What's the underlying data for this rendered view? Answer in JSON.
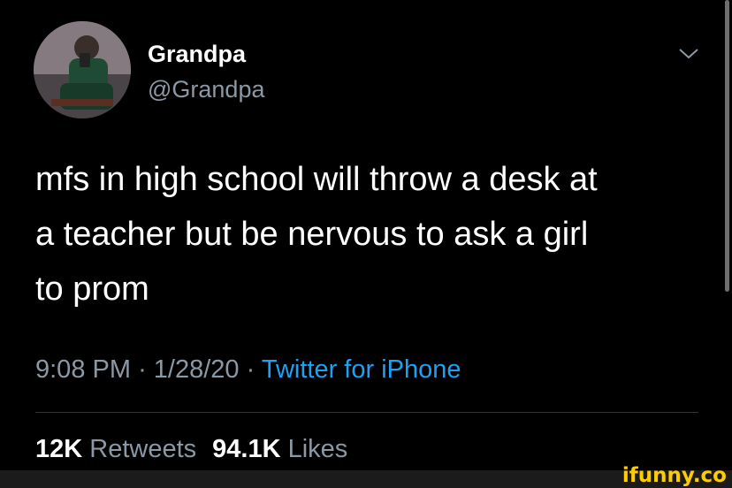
{
  "tweet": {
    "author": {
      "display_name": "Grandpa",
      "handle": "@Grandpa",
      "avatar_icon": "profile-photo"
    },
    "text_lines": [
      "mfs in high school will throw a desk at",
      "a teacher but be nervous to ask a girl",
      "to prom"
    ],
    "time": "9:08 PM",
    "date": "1/28/20",
    "separator": "·",
    "source": "Twitter for iPhone",
    "retweets_count": "12K",
    "retweets_label": "Retweets",
    "likes_count": "94.1K",
    "likes_label": "Likes"
  },
  "menu_icon": "chevron-down-icon",
  "watermark": "ifunny.co",
  "colors": {
    "background": "#000000",
    "text": "#ffffff",
    "secondary_text": "#8b98a5",
    "link": "#1da1f2",
    "divider": "#2f3336",
    "watermark": "#ffcc00"
  }
}
